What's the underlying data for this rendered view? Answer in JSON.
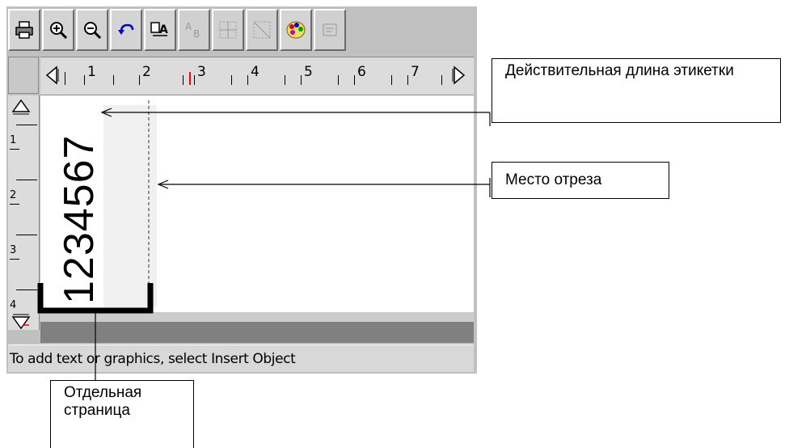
{
  "toolbar": {
    "buttons": [
      {
        "name": "print-button",
        "icon": "printer-icon"
      },
      {
        "name": "zoom-in-button",
        "icon": "zoom-in-icon"
      },
      {
        "name": "zoom-out-button",
        "icon": "zoom-out-icon"
      },
      {
        "name": "undo-button",
        "icon": "undo-icon"
      },
      {
        "name": "text-style-button",
        "icon": "text-style-icon"
      },
      {
        "name": "text-format-button",
        "icon": "text-format-icon",
        "disabled": true
      },
      {
        "name": "align-button",
        "icon": "align-icon",
        "disabled": true
      },
      {
        "name": "align2-button",
        "icon": "align-icon",
        "disabled": true
      },
      {
        "name": "color-button",
        "icon": "palette-icon"
      },
      {
        "name": "properties-button",
        "icon": "properties-icon",
        "disabled": true
      }
    ]
  },
  "ruler": {
    "h_numbers": [
      "1",
      "2",
      "3",
      "4",
      "5",
      "6",
      "7"
    ],
    "v_numbers": [
      "1",
      "2",
      "3",
      "4"
    ]
  },
  "label": {
    "text": "1234567"
  },
  "status_bar": {
    "text": "To add text or graphics, select Insert Object"
  },
  "callouts": {
    "label_length": "Действительная длина этикетки",
    "cut_place": "Место отреза",
    "separate_page": "Отдельная страница"
  },
  "colors": {
    "window_bg": "#c0c0c0",
    "ruler_marker": "#ff0000",
    "canvas": "#ffffff"
  }
}
